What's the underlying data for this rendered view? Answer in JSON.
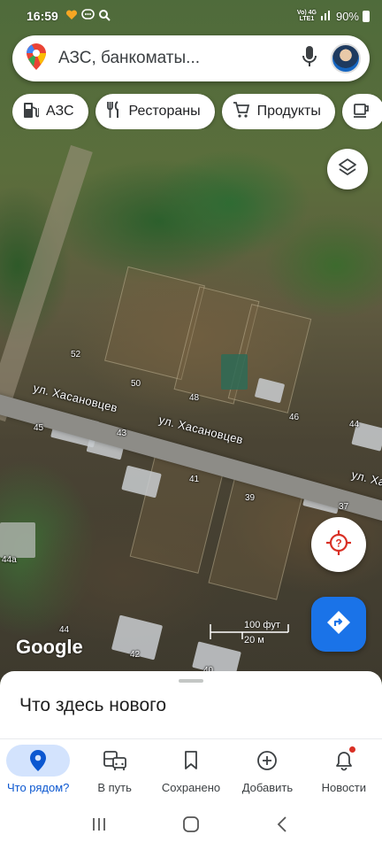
{
  "status_bar": {
    "time": "16:59",
    "network_top": "Vo) 4G",
    "network_bottom": "LTE1",
    "battery": "90%"
  },
  "search": {
    "placeholder": "АЗС, банкоматы..."
  },
  "chips": [
    {
      "label": "АЗС",
      "icon": "gas-station-icon"
    },
    {
      "label": "Рестораны",
      "icon": "restaurant-icon"
    },
    {
      "label": "Продукты",
      "icon": "cart-icon"
    }
  ],
  "map": {
    "street_labels": [
      "ул. Хасановцев",
      "ул. Хасановцев",
      "ул. Ха"
    ],
    "house_numbers": [
      "52",
      "50",
      "48",
      "46",
      "44",
      "45",
      "43",
      "41",
      "39",
      "37",
      "44а",
      "44",
      "42",
      "40"
    ],
    "google_logo": "Google",
    "scale": {
      "imperial": "100 фут",
      "metric": "20 м"
    }
  },
  "bottom_sheet": {
    "title": "Что здесь нового"
  },
  "bottom_nav": [
    {
      "label": "Что рядом?",
      "icon": "location-pin-icon",
      "active": true
    },
    {
      "label": "В путь",
      "icon": "commute-icon",
      "active": false
    },
    {
      "label": "Сохранено",
      "icon": "bookmark-icon",
      "active": false
    },
    {
      "label": "Добавить",
      "icon": "add-circle-icon",
      "active": false
    },
    {
      "label": "Новости",
      "icon": "bell-icon",
      "active": false
    }
  ],
  "colors": {
    "accent": "#1a73e8",
    "active_nav_bg": "#d3e3fd",
    "location_red": "#d93025"
  }
}
